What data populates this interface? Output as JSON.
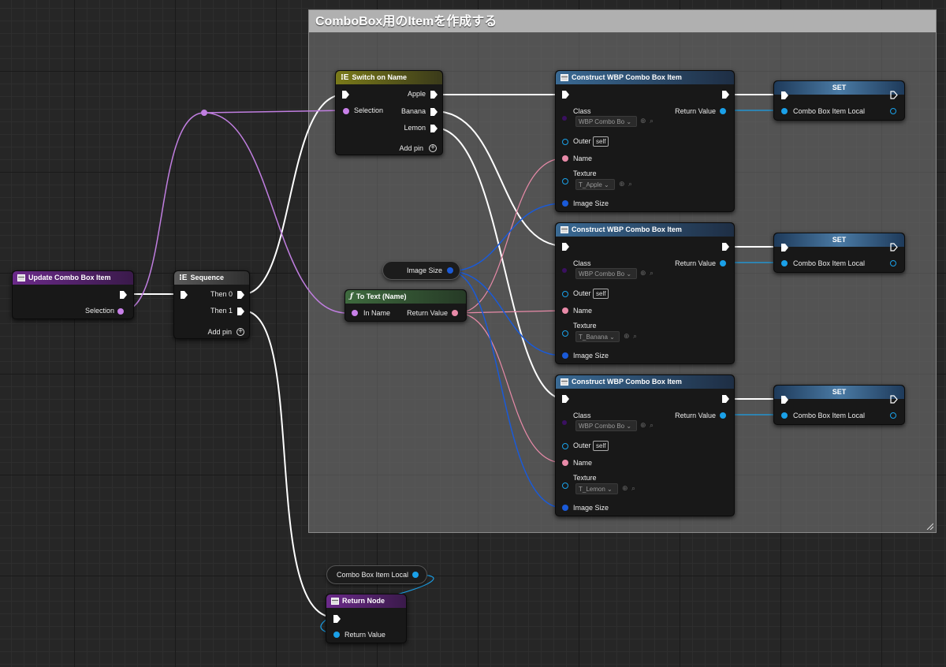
{
  "comment": {
    "title": "ComboBox用のItemを作成する"
  },
  "colors": {
    "exec": "#ffffff",
    "name_pin": "#c880e8",
    "text_pin": "#e88aa8",
    "object_pin": "#1aa0e8",
    "vector_pin": "#1a5ad8",
    "class_pin": "#5a20a0"
  },
  "entry_node": {
    "title": "Update Combo Box Item",
    "selection": "Selection"
  },
  "sequence": {
    "title": "Sequence",
    "then0": "Then 0",
    "then1": "Then 1",
    "add_pin": "Add pin"
  },
  "switch": {
    "title": "Switch on Name",
    "selection": "Selection",
    "apple": "Apple",
    "banana": "Banana",
    "lemon": "Lemon",
    "add_pin": "Add pin"
  },
  "image_size_var": {
    "label": "Image Size"
  },
  "to_text": {
    "title": "To Text (Name)",
    "in_name": "In Name",
    "return_value": "Return Value"
  },
  "construct_nodes": [
    {
      "title": "Construct WBP Combo Box Item",
      "class_label": "Class",
      "class_value": "WBP Combo Bo",
      "return_value": "Return Value",
      "outer": "Outer",
      "outer_value": "self",
      "name": "Name",
      "texture": "Texture",
      "texture_value": "T_Apple",
      "image_size": "Image Size"
    },
    {
      "title": "Construct WBP Combo Box Item",
      "class_label": "Class",
      "class_value": "WBP Combo Bo",
      "return_value": "Return Value",
      "outer": "Outer",
      "outer_value": "self",
      "name": "Name",
      "texture": "Texture",
      "texture_value": "T_Banana",
      "image_size": "Image Size"
    },
    {
      "title": "Construct WBP Combo Box Item",
      "class_label": "Class",
      "class_value": "WBP Combo Bo",
      "return_value": "Return Value",
      "outer": "Outer",
      "outer_value": "self",
      "name": "Name",
      "texture": "Texture",
      "texture_value": "T_Lemon",
      "image_size": "Image Size"
    }
  ],
  "set_nodes": [
    {
      "title": "SET",
      "var": "Combo Box Item Local"
    },
    {
      "title": "SET",
      "var": "Combo Box Item Local"
    },
    {
      "title": "SET",
      "var": "Combo Box Item Local"
    }
  ],
  "combo_var": {
    "label": "Combo Box Item Local"
  },
  "return_node": {
    "title": "Return Node",
    "return_value": "Return Value"
  }
}
